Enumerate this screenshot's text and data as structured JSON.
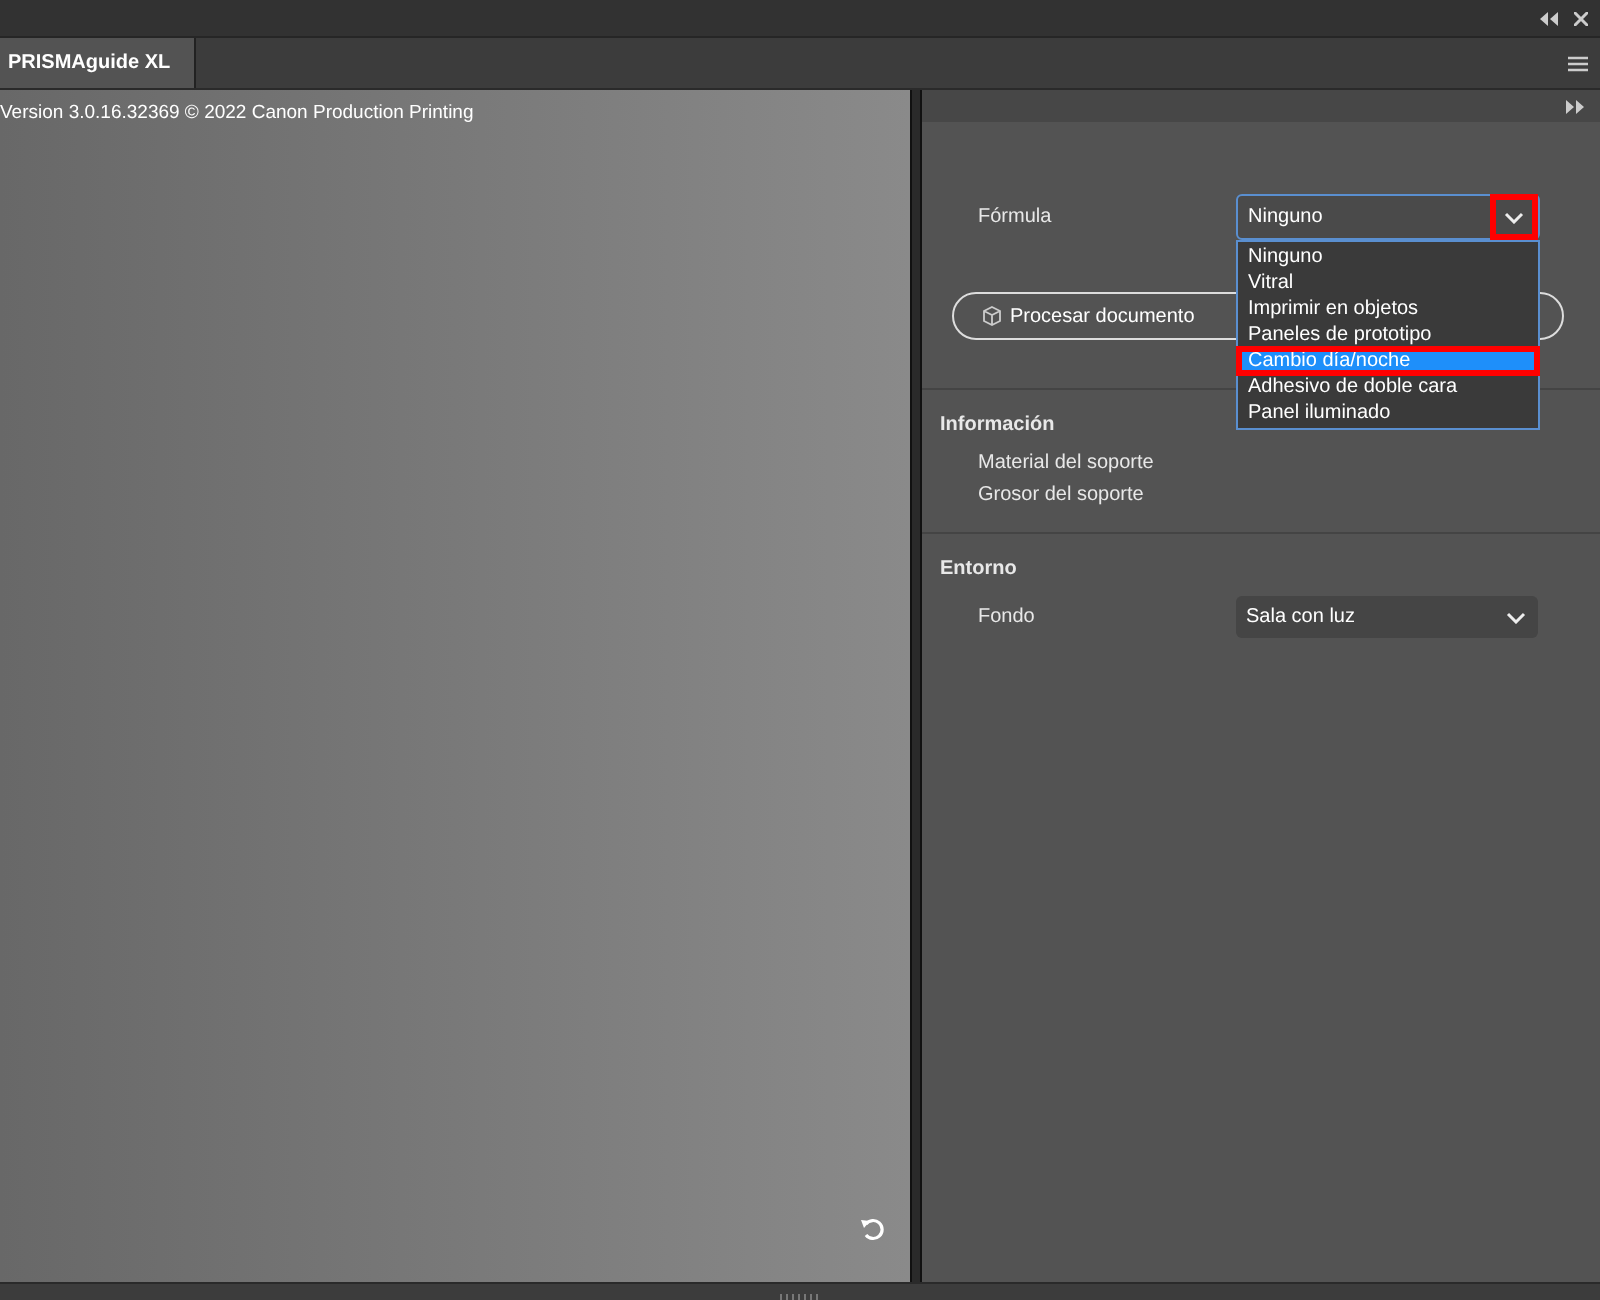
{
  "tabs": [
    {
      "label": "PRISMAguide XL",
      "selected": true
    }
  ],
  "preview": {
    "version": "Version 3.0.16.32369 © 2022 Canon Production Printing"
  },
  "formula": {
    "label": "Fórmula",
    "value": "Ninguno",
    "button_annotated": true,
    "options": [
      {
        "label": "Ninguno",
        "highlighted": false,
        "annotated": false
      },
      {
        "label": "Vitral",
        "highlighted": false,
        "annotated": false
      },
      {
        "label": "Imprimir en objetos",
        "highlighted": false,
        "annotated": false
      },
      {
        "label": "Paneles de prototipo",
        "highlighted": false,
        "annotated": false
      },
      {
        "label": "Cambio día/noche",
        "highlighted": true,
        "annotated": true
      },
      {
        "label": "Adhesivo de doble cara",
        "highlighted": false,
        "annotated": false
      },
      {
        "label": "Panel iluminado",
        "highlighted": false,
        "annotated": false
      }
    ]
  },
  "process_button": {
    "label": "Procesar documento"
  },
  "information": {
    "title": "Información",
    "items": [
      "Material del soporte",
      "Grosor del soporte"
    ]
  },
  "environment": {
    "title": "Entorno",
    "label": "Fondo",
    "value": "Sala con luz"
  }
}
